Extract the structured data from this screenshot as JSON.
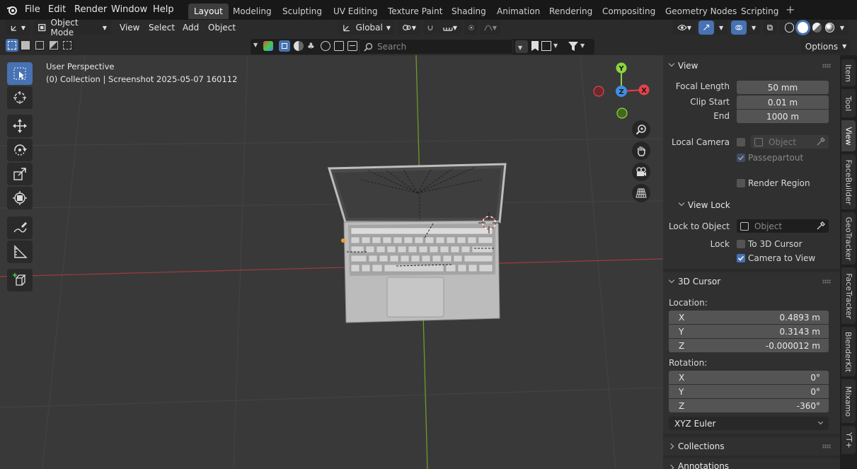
{
  "menu": {
    "file": "File",
    "edit": "Edit",
    "render": "Render",
    "window": "Window",
    "help": "Help"
  },
  "workspaces": [
    "Layout",
    "Modeling",
    "Sculpting",
    "UV Editing",
    "Texture Paint",
    "Shading",
    "Animation",
    "Rendering",
    "Compositing",
    "Geometry Nodes",
    "Scripting"
  ],
  "header": {
    "mode": "Object Mode",
    "menus": {
      "view": "View",
      "select": "Select",
      "add": "Add",
      "object": "Object"
    },
    "orientation": "Global",
    "search_placeholder": "Search",
    "options": "Options"
  },
  "viewport": {
    "perspective": "User Perspective",
    "collection": "(0) Collection | Screenshot 2025-05-07 160112",
    "gizmo": {
      "y": "Y",
      "z": "Z",
      "x": "X"
    },
    "colors": {
      "x_axis": "#e8414b",
      "y_axis": "#8bd63e",
      "z_axis": "#3d8fe5",
      "grid": "#4a4a4a"
    }
  },
  "view_panel": {
    "title": "View",
    "focal_length": {
      "label": "Focal Length",
      "value": "50 mm"
    },
    "clip_start": {
      "label": "Clip Start",
      "value": "0.01 m"
    },
    "clip_end": {
      "label": "End",
      "value": "1000 m"
    },
    "local_camera": {
      "label": "Local Camera",
      "placeholder": "Object"
    },
    "passepartout": "Passepartout",
    "render_region": "Render Region",
    "view_lock": {
      "title": "View Lock",
      "lock_to_object": {
        "label": "Lock to Object",
        "placeholder": "Object"
      },
      "lock_label": "Lock",
      "to_3d_cursor": "To 3D Cursor",
      "camera_to_view": "Camera to View"
    }
  },
  "cursor_panel": {
    "title": "3D Cursor",
    "location_label": "Location:",
    "location": [
      {
        "axis": "X",
        "value": "0.4893 m"
      },
      {
        "axis": "Y",
        "value": "0.3143 m"
      },
      {
        "axis": "Z",
        "value": "-0.000012 m"
      }
    ],
    "rotation_label": "Rotation:",
    "rotation": [
      {
        "axis": "X",
        "value": "0°"
      },
      {
        "axis": "Y",
        "value": "0°"
      },
      {
        "axis": "Z",
        "value": "-360°"
      }
    ],
    "rotation_mode": "XYZ Euler"
  },
  "collections": "Collections",
  "annotations": "Annotations",
  "side_tabs": [
    "Item",
    "Tool",
    "View",
    "FaceBuilder",
    "GeoTracker",
    "FaceTracker",
    "BlenderKit",
    "Mixamo",
    "YT+"
  ]
}
